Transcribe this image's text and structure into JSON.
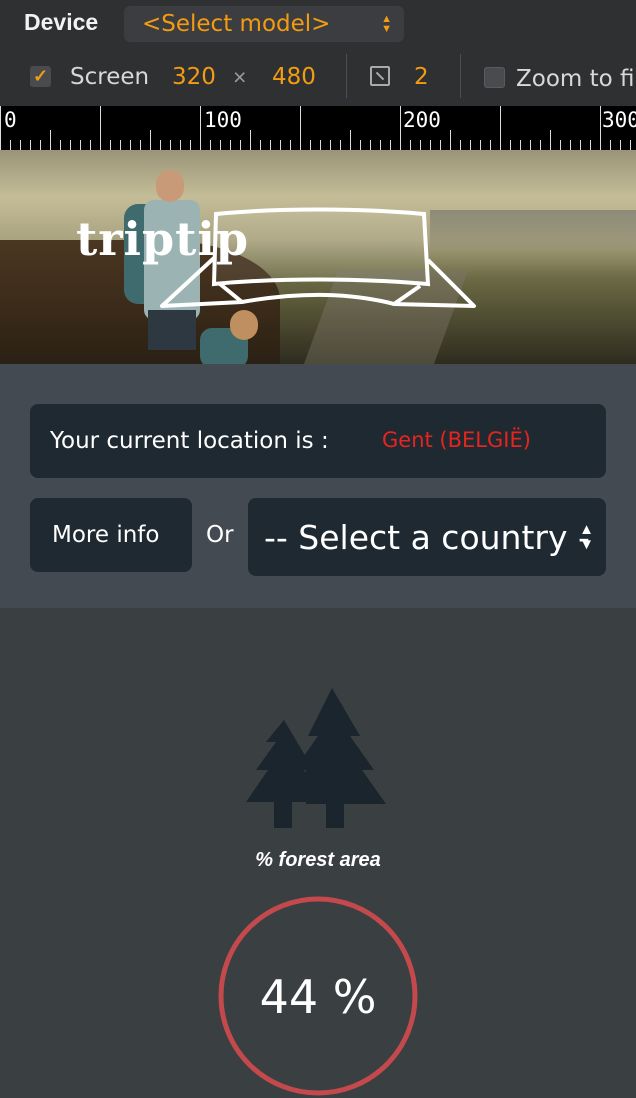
{
  "devtools": {
    "device_label": "Device",
    "model_select": "<Select model>",
    "screen_enabled": true,
    "screen_label": "Screen",
    "screen_width": "320",
    "screen_times": "×",
    "screen_height": "480",
    "pixel_ratio": "2",
    "zoom_to_fit_enabled": false,
    "zoom_label": "Zoom to fi",
    "ruler": [
      "0",
      "100",
      "200",
      "300"
    ]
  },
  "hero": {
    "logo_text": "triptip"
  },
  "location": {
    "label": "Your current location is :",
    "value": "Gent (BELGIË)"
  },
  "actions": {
    "more_info": "More info",
    "or_label": "Or",
    "country_select": "-- Select a country -"
  },
  "forest": {
    "label": "% forest area",
    "value_text": "44 %",
    "value": 44
  },
  "colors": {
    "accent_orange": "#f39c12",
    "location_red": "#e8241e",
    "ring_red": "#c4494d",
    "panel_dark": "#1e2932",
    "tree_dark": "#1b252d"
  },
  "icons": {
    "checkbox": "checkmark-icon",
    "pixel_ratio": "resize-icon",
    "forest": "trees-icon"
  }
}
